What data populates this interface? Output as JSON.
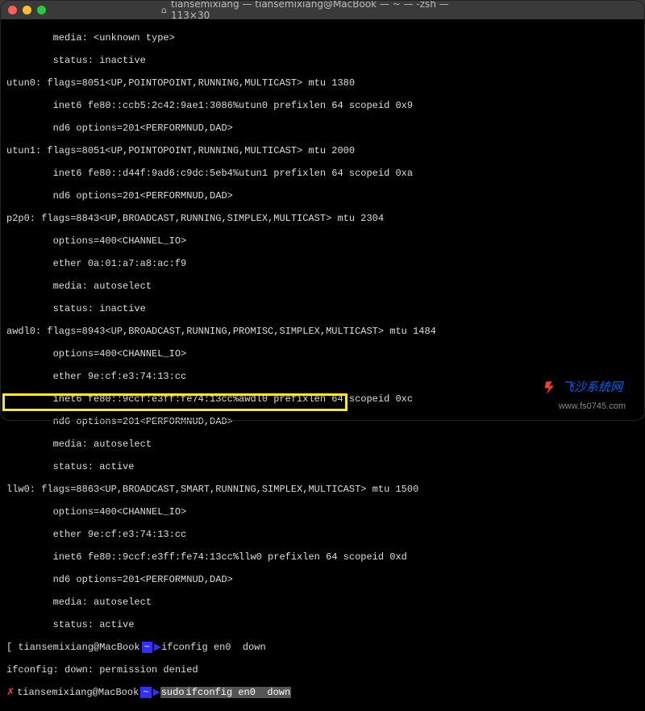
{
  "window": {
    "title": "tiansemixiang — tiansemixiang@MacBook — ~ — -zsh — 113×30"
  },
  "lines": {
    "l0": "        media: <unknown type>",
    "l1": "        status: inactive",
    "l2": "utun0: flags=8051<UP,POINTOPOINT,RUNNING,MULTICAST> mtu 1380",
    "l3": "        inet6 fe80::ccb5:2c42:9ae1:3086%utun0 prefixlen 64 scopeid 0x9",
    "l4": "        nd6 options=201<PERFORMNUD,DAD>",
    "l5": "utun1: flags=8051<UP,POINTOPOINT,RUNNING,MULTICAST> mtu 2000",
    "l6": "        inet6 fe80::d44f:9ad6:c9dc:5eb4%utun1 prefixlen 64 scopeid 0xa",
    "l7": "        nd6 options=201<PERFORMNUD,DAD>",
    "l8": "p2p0: flags=8843<UP,BROADCAST,RUNNING,SIMPLEX,MULTICAST> mtu 2304",
    "l9": "        options=400<CHANNEL_IO>",
    "l10": "        ether 0a:01:a7:a8:ac:f9",
    "l11": "        media: autoselect",
    "l12": "        status: inactive",
    "l13": "awdl0: flags=8943<UP,BROADCAST,RUNNING,PROMISC,SIMPLEX,MULTICAST> mtu 1484",
    "l14": "        options=400<CHANNEL_IO>",
    "l15": "        ether 9e:cf:e3:74:13:cc",
    "l16": "        inet6 fe80::9ccf:e3ff:fe74:13cc%awdl0 prefixlen 64 scopeid 0xc",
    "l17": "        nd6 options=201<PERFORMNUD,DAD>",
    "l18": "        media: autoselect",
    "l19": "        status: active",
    "l20": "llw0: flags=8863<UP,BROADCAST,SMART,RUNNING,SIMPLEX,MULTICAST> mtu 1500",
    "l21": "        options=400<CHANNEL_IO>",
    "l22": "        ether 9e:cf:e3:74:13:cc",
    "l23": "        inet6 fe80::9ccf:e3ff:fe74:13cc%llw0 prefixlen 64 scopeid 0xd",
    "l24": "        nd6 options=201<PERFORMNUD,DAD>",
    "l25": "        media: autoselect",
    "l26": "        status: active"
  },
  "prompt1": {
    "user_host": "tiansemixiang@MacBook",
    "path": "~",
    "cmd": "ifconfig en0  down"
  },
  "error": "ifconfig: down: permission denied",
  "prompt2": {
    "user_host": "tiansemixiang@MacBook",
    "path": "~",
    "sudo": "sudo",
    "cmd": "ifconfig en0  down"
  },
  "watermark": {
    "text": "飞沙系统网",
    "url": "www.fs0745.com"
  }
}
